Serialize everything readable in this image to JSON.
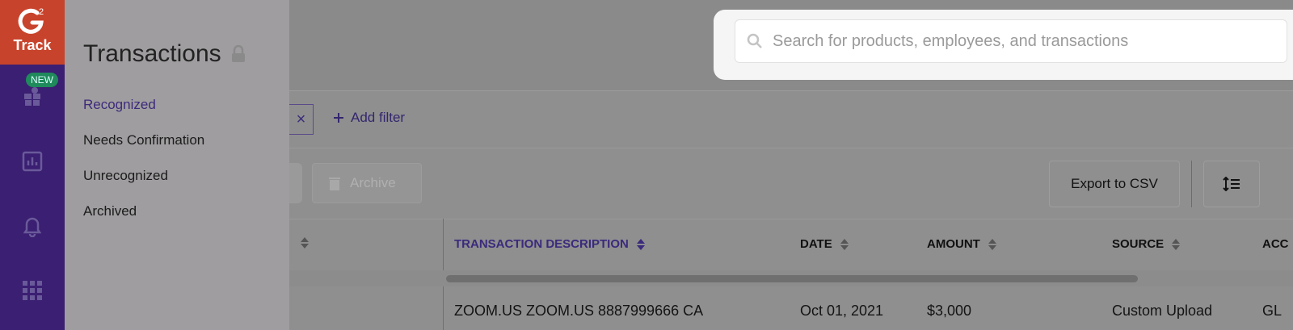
{
  "logo": {
    "brand_top": "2",
    "brand_text": "Track"
  },
  "rail": {
    "new_badge": "NEW"
  },
  "drawer": {
    "title": "Transactions",
    "items": [
      {
        "label": "Recognized",
        "active": true
      },
      {
        "label": "Needs Confirmation",
        "active": false
      },
      {
        "label": "Unrecognized",
        "active": false
      },
      {
        "label": "Archived",
        "active": false
      }
    ]
  },
  "filters": {
    "add_filter_label": "Add filter",
    "chip_close": "×"
  },
  "toolbar": {
    "archive_label": "Archive",
    "export_label": "Export to CSV"
  },
  "table": {
    "columns": [
      {
        "label": "TRANSACTION DESCRIPTION",
        "active": true
      },
      {
        "label": "DATE"
      },
      {
        "label": "AMOUNT"
      },
      {
        "label": "SOURCE"
      },
      {
        "label": "ACC"
      }
    ],
    "rows": [
      {
        "description": "ZOOM.US ZOOM.US 8887999666 CA",
        "date": "Oct 01, 2021",
        "amount": "$3,000",
        "source": "Custom Upload",
        "account": "GL"
      }
    ]
  },
  "search": {
    "placeholder": "Search for products, employees, and transactions",
    "value": ""
  },
  "colors": {
    "brand_red": "#c8432b",
    "rail_purple": "#3b1f72",
    "accent_purple": "#3d2a7c",
    "badge_green": "#1f8a5b"
  }
}
